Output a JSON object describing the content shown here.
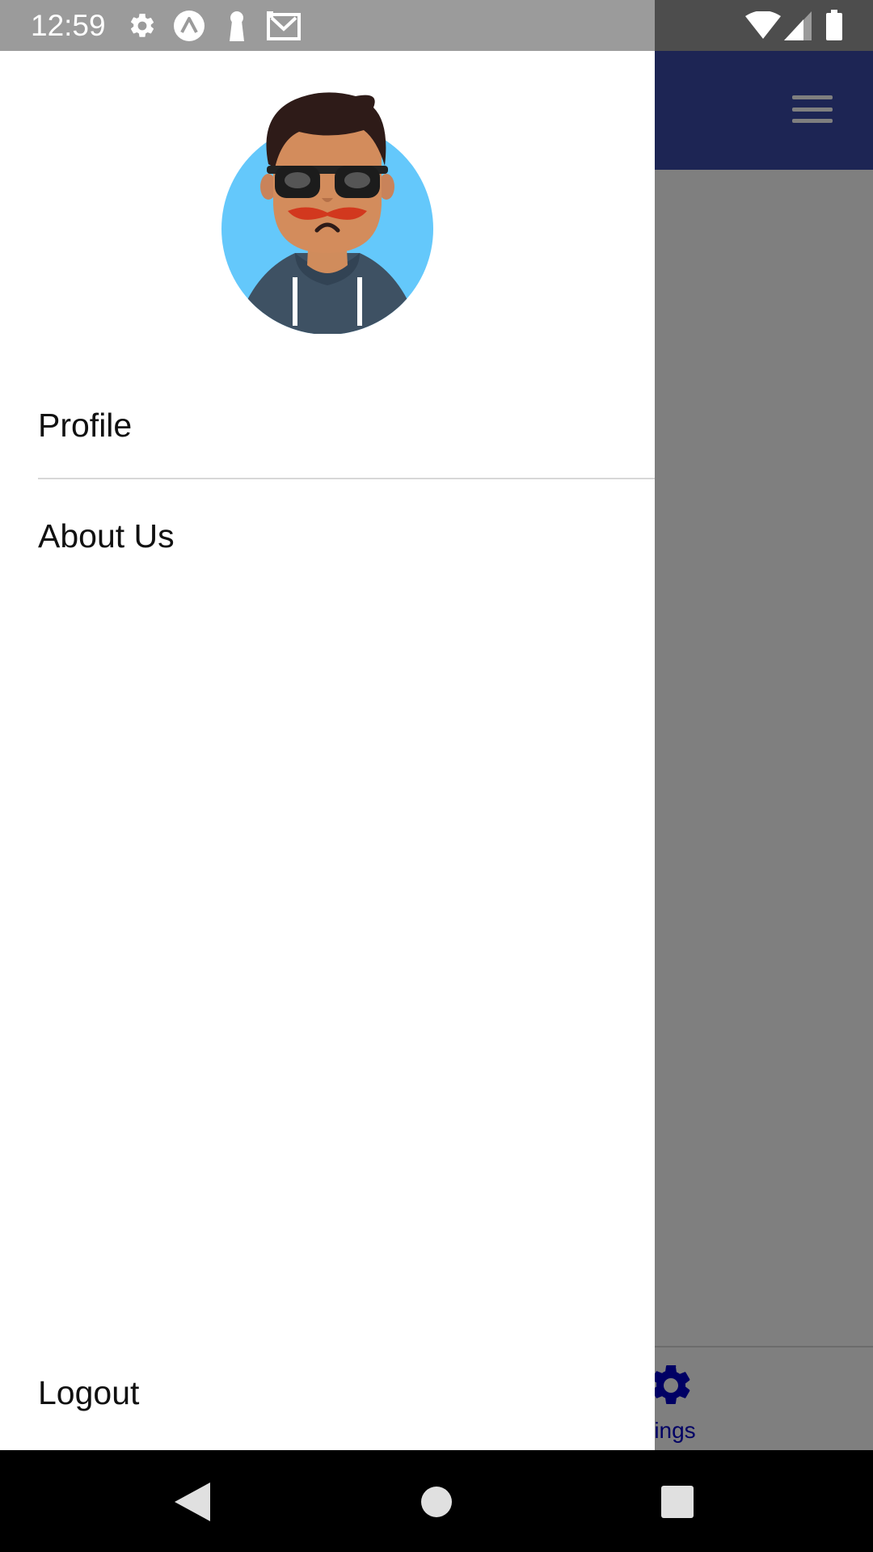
{
  "status_bar": {
    "time": "12:59",
    "left_icons": [
      "gear-icon",
      "expo-icon",
      "keyhole-icon",
      "gmail-icon"
    ],
    "right_icons": [
      "wifi-icon",
      "signal-icon",
      "battery-icon"
    ]
  },
  "app": {
    "header_color": "#3a4ba8",
    "menu_icon": "hamburger-menu-icon",
    "bottom_tab": {
      "icon": "gear-icon",
      "label": "ings"
    }
  },
  "drawer": {
    "avatar": "avatar-illustration",
    "items": [
      {
        "label": "Profile"
      },
      {
        "label": "About Us"
      }
    ],
    "footer_item": {
      "label": "Logout"
    }
  },
  "nav_bar": {
    "buttons": [
      "back-icon",
      "home-icon",
      "recents-icon"
    ]
  }
}
